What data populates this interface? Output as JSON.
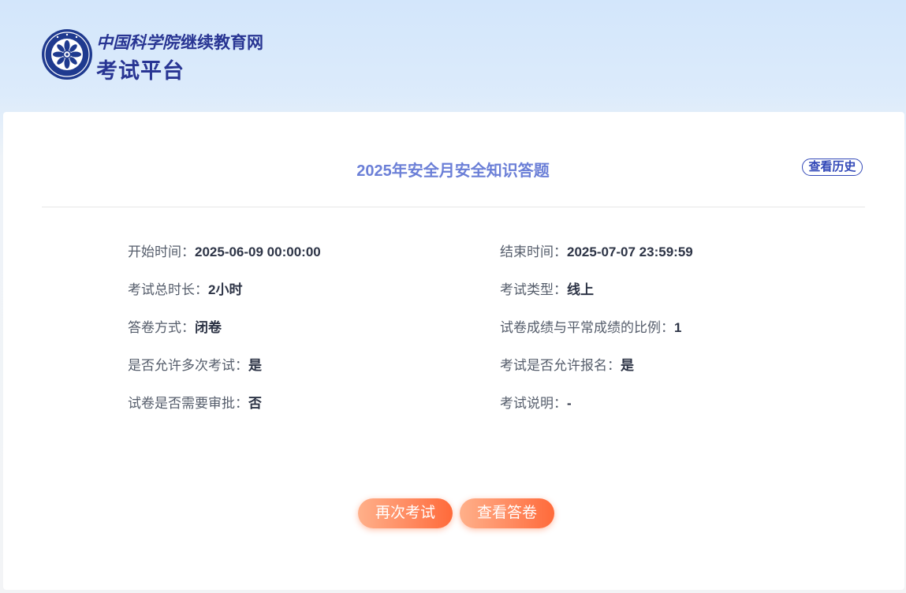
{
  "header": {
    "brand_line1_seal": "中国科学院",
    "brand_line1_rest": "继续教育网",
    "brand_line2": "考试平台"
  },
  "exam": {
    "title": "2025年安全月安全知识答题",
    "history_label": "查看历史"
  },
  "info": {
    "left": [
      {
        "label": "开始时间：",
        "value": "2025-06-09 00:00:00"
      },
      {
        "label": "考试总时长：",
        "value": "2小时"
      },
      {
        "label": "答卷方式：",
        "value": "闭卷"
      },
      {
        "label": "是否允许多次考试：",
        "value": "是"
      },
      {
        "label": "试卷是否需要审批：",
        "value": "否"
      }
    ],
    "right": [
      {
        "label": "结束时间：",
        "value": "2025-07-07 23:59:59"
      },
      {
        "label": "考试类型：",
        "value": "线上"
      },
      {
        "label": "试卷成绩与平常成绩的比例：",
        "value": "1"
      },
      {
        "label": "考试是否允许报名：",
        "value": "是"
      },
      {
        "label": "考试说明：",
        "value": "-"
      }
    ]
  },
  "actions": {
    "retake_label": "再次考试",
    "view_answers_label": "查看答卷"
  },
  "colors": {
    "brand": "#283593",
    "title": "#6b7fd7",
    "accent_button": "#ff7a4a"
  }
}
